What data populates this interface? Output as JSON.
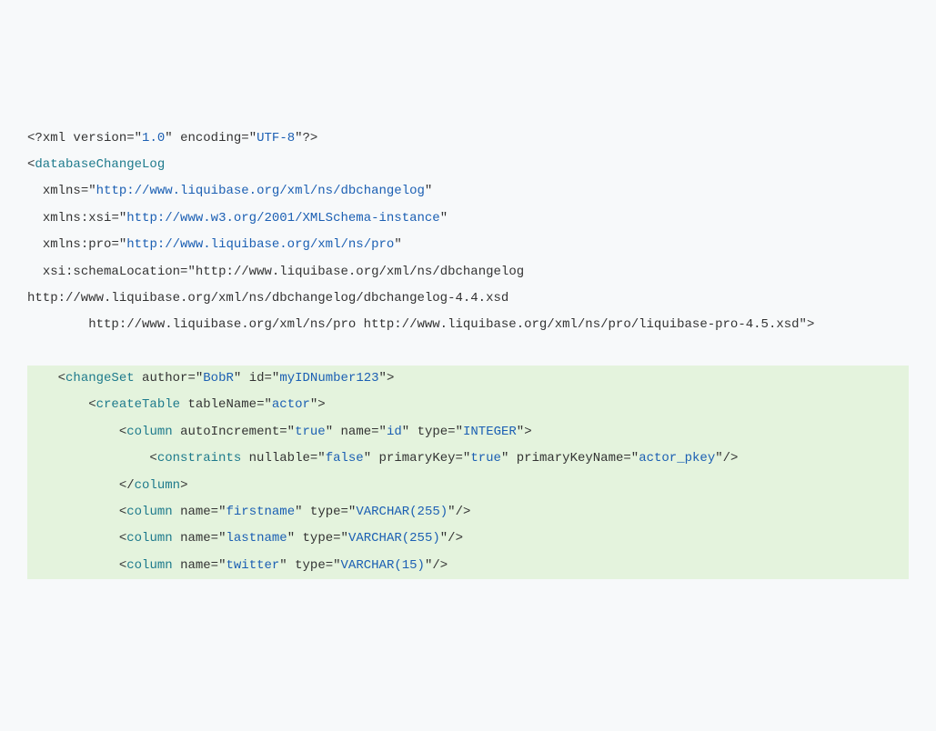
{
  "lines": [
    {
      "hl": false,
      "indent": 0,
      "tokens": [
        {
          "t": "<?",
          "c": "punct"
        },
        {
          "t": "xml version",
          "c": "xml-decl"
        },
        {
          "t": "=\"",
          "c": "punct"
        },
        {
          "t": "1.0",
          "c": "attr-val"
        },
        {
          "t": "\" ",
          "c": "punct"
        },
        {
          "t": "encoding",
          "c": "xml-decl"
        },
        {
          "t": "=\"",
          "c": "punct"
        },
        {
          "t": "UTF-8",
          "c": "attr-val"
        },
        {
          "t": "\"?>",
          "c": "punct"
        }
      ]
    },
    {
      "hl": false,
      "indent": 0,
      "tokens": [
        {
          "t": "<",
          "c": "punct"
        },
        {
          "t": "databaseChangeLog",
          "c": "tag"
        }
      ]
    },
    {
      "hl": false,
      "indent": 2,
      "tokens": [
        {
          "t": "xmlns",
          "c": "attr-name"
        },
        {
          "t": "=\"",
          "c": "punct"
        },
        {
          "t": "http://www.liquibase.org/xml/ns/dbchangelog",
          "c": "attr-val"
        },
        {
          "t": "\"",
          "c": "punct"
        }
      ]
    },
    {
      "hl": false,
      "indent": 2,
      "tokens": [
        {
          "t": "xmlns:xsi",
          "c": "attr-name"
        },
        {
          "t": "=\"",
          "c": "punct"
        },
        {
          "t": "http://www.w3.org/2001/XMLSchema-instance",
          "c": "attr-val"
        },
        {
          "t": "\"",
          "c": "punct"
        }
      ]
    },
    {
      "hl": false,
      "indent": 2,
      "tokens": [
        {
          "t": "xmlns:pro",
          "c": "attr-name"
        },
        {
          "t": "=\"",
          "c": "punct"
        },
        {
          "t": "http://www.liquibase.org/xml/ns/pro",
          "c": "attr-val"
        },
        {
          "t": "\"",
          "c": "punct"
        }
      ]
    },
    {
      "hl": false,
      "indent": 2,
      "tokens": [
        {
          "t": "xsi:schemaLocation",
          "c": "attr-name"
        },
        {
          "t": "=\"",
          "c": "punct"
        },
        {
          "t": "http://www.liquibase.org/xml/ns/dbchangelog",
          "c": "attr-name"
        }
      ]
    },
    {
      "hl": false,
      "indent": 0,
      "tokens": [
        {
          "t": "http://www.liquibase.org/xml/ns/dbchangelog/dbchangelog-4.4.xsd",
          "c": "attr-name"
        }
      ]
    },
    {
      "hl": false,
      "indent": 8,
      "tokens": [
        {
          "t": "http://www.liquibase.org/xml/ns/pro http://www.liquibase.org/xml/ns/pro/liquibase-pro-4.5.xsd",
          "c": "attr-name"
        },
        {
          "t": "\">",
          "c": "punct"
        }
      ]
    },
    {
      "hl": false,
      "indent": 0,
      "tokens": [
        {
          "t": " ",
          "c": "punct"
        }
      ]
    },
    {
      "hl": true,
      "indent": 4,
      "tokens": [
        {
          "t": "<",
          "c": "punct"
        },
        {
          "t": "changeSet",
          "c": "tag"
        },
        {
          "t": " ",
          "c": "punct"
        },
        {
          "t": "author",
          "c": "attr-name"
        },
        {
          "t": "=\"",
          "c": "punct"
        },
        {
          "t": "BobR",
          "c": "attr-val"
        },
        {
          "t": "\" ",
          "c": "punct"
        },
        {
          "t": "id",
          "c": "attr-name"
        },
        {
          "t": "=\"",
          "c": "punct"
        },
        {
          "t": "myIDNumber123",
          "c": "attr-val"
        },
        {
          "t": "\">",
          "c": "punct"
        }
      ]
    },
    {
      "hl": true,
      "indent": 8,
      "tokens": [
        {
          "t": "<",
          "c": "punct"
        },
        {
          "t": "createTable",
          "c": "tag"
        },
        {
          "t": " ",
          "c": "punct"
        },
        {
          "t": "tableName",
          "c": "attr-name"
        },
        {
          "t": "=\"",
          "c": "punct"
        },
        {
          "t": "actor",
          "c": "attr-val"
        },
        {
          "t": "\">",
          "c": "punct"
        }
      ]
    },
    {
      "hl": true,
      "indent": 12,
      "tokens": [
        {
          "t": "<",
          "c": "punct"
        },
        {
          "t": "column",
          "c": "tag"
        },
        {
          "t": " ",
          "c": "punct"
        },
        {
          "t": "autoIncrement",
          "c": "attr-name"
        },
        {
          "t": "=\"",
          "c": "punct"
        },
        {
          "t": "true",
          "c": "attr-val"
        },
        {
          "t": "\" ",
          "c": "punct"
        },
        {
          "t": "name",
          "c": "attr-name"
        },
        {
          "t": "=\"",
          "c": "punct"
        },
        {
          "t": "id",
          "c": "attr-val"
        },
        {
          "t": "\" ",
          "c": "punct"
        },
        {
          "t": "type",
          "c": "attr-name"
        },
        {
          "t": "=\"",
          "c": "punct"
        },
        {
          "t": "INTEGER",
          "c": "attr-val"
        },
        {
          "t": "\">",
          "c": "punct"
        }
      ]
    },
    {
      "hl": true,
      "indent": 16,
      "tokens": [
        {
          "t": "<",
          "c": "punct"
        },
        {
          "t": "constraints",
          "c": "tag"
        },
        {
          "t": " ",
          "c": "punct"
        },
        {
          "t": "nullable",
          "c": "attr-name"
        },
        {
          "t": "=\"",
          "c": "punct"
        },
        {
          "t": "false",
          "c": "attr-val"
        },
        {
          "t": "\" ",
          "c": "punct"
        },
        {
          "t": "primaryKey",
          "c": "attr-name"
        },
        {
          "t": "=\"",
          "c": "punct"
        },
        {
          "t": "true",
          "c": "attr-val"
        },
        {
          "t": "\" ",
          "c": "punct"
        },
        {
          "t": "primaryKeyName",
          "c": "attr-name"
        },
        {
          "t": "=\"",
          "c": "punct"
        },
        {
          "t": "actor_pkey",
          "c": "attr-val"
        },
        {
          "t": "\"/>",
          "c": "punct"
        }
      ]
    },
    {
      "hl": true,
      "indent": 12,
      "tokens": [
        {
          "t": "</",
          "c": "punct"
        },
        {
          "t": "column",
          "c": "tag"
        },
        {
          "t": ">",
          "c": "punct"
        }
      ]
    },
    {
      "hl": true,
      "indent": 12,
      "tokens": [
        {
          "t": "<",
          "c": "punct"
        },
        {
          "t": "column",
          "c": "tag"
        },
        {
          "t": " ",
          "c": "punct"
        },
        {
          "t": "name",
          "c": "attr-name"
        },
        {
          "t": "=\"",
          "c": "punct"
        },
        {
          "t": "firstname",
          "c": "attr-val"
        },
        {
          "t": "\" ",
          "c": "punct"
        },
        {
          "t": "type",
          "c": "attr-name"
        },
        {
          "t": "=\"",
          "c": "punct"
        },
        {
          "t": "VARCHAR(255)",
          "c": "attr-val"
        },
        {
          "t": "\"/>",
          "c": "punct"
        }
      ]
    },
    {
      "hl": true,
      "indent": 12,
      "tokens": [
        {
          "t": "<",
          "c": "punct"
        },
        {
          "t": "column",
          "c": "tag"
        },
        {
          "t": " ",
          "c": "punct"
        },
        {
          "t": "name",
          "c": "attr-name"
        },
        {
          "t": "=\"",
          "c": "punct"
        },
        {
          "t": "lastname",
          "c": "attr-val"
        },
        {
          "t": "\" ",
          "c": "punct"
        },
        {
          "t": "type",
          "c": "attr-name"
        },
        {
          "t": "=\"",
          "c": "punct"
        },
        {
          "t": "VARCHAR(255)",
          "c": "attr-val"
        },
        {
          "t": "\"/>",
          "c": "punct"
        }
      ]
    },
    {
      "hl": true,
      "indent": 12,
      "tokens": [
        {
          "t": "<",
          "c": "punct"
        },
        {
          "t": "column",
          "c": "tag"
        },
        {
          "t": " ",
          "c": "punct"
        },
        {
          "t": "name",
          "c": "attr-name"
        },
        {
          "t": "=\"",
          "c": "punct"
        },
        {
          "t": "twitter",
          "c": "attr-val"
        },
        {
          "t": "\" ",
          "c": "punct"
        },
        {
          "t": "type",
          "c": "attr-name"
        },
        {
          "t": "=\"",
          "c": "punct"
        },
        {
          "t": "VARCHAR(15)",
          "c": "attr-val"
        },
        {
          "t": "\"/>",
          "c": "punct"
        }
      ]
    }
  ]
}
